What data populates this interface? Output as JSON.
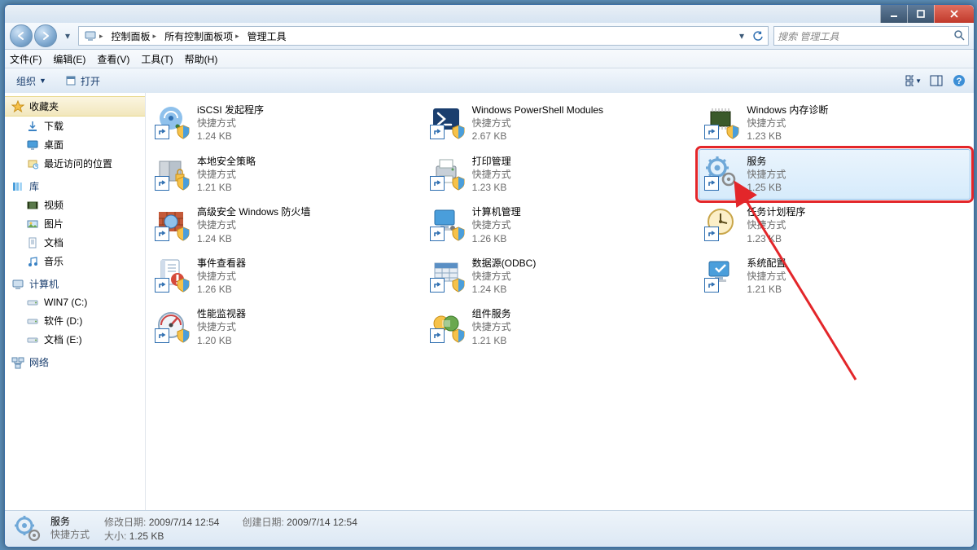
{
  "titlebar": {},
  "breadcrumb": {
    "root_icon": "computer",
    "segments": [
      "控制面板",
      "所有控制面板项",
      "管理工具"
    ]
  },
  "search": {
    "placeholder": "搜索 管理工具"
  },
  "menubar": [
    "文件(F)",
    "编辑(E)",
    "查看(V)",
    "工具(T)",
    "帮助(H)"
  ],
  "toolbar": {
    "organize": "组织",
    "open": "打开"
  },
  "sidebar": {
    "favorites": {
      "title": "收藏夹",
      "items": [
        {
          "label": "下载",
          "icon": "download"
        },
        {
          "label": "桌面",
          "icon": "desktop"
        },
        {
          "label": "最近访问的位置",
          "icon": "recent"
        }
      ]
    },
    "libraries": {
      "title": "库",
      "items": [
        {
          "label": "视频",
          "icon": "video"
        },
        {
          "label": "图片",
          "icon": "pictures"
        },
        {
          "label": "文档",
          "icon": "docs"
        },
        {
          "label": "音乐",
          "icon": "music"
        }
      ]
    },
    "computer": {
      "title": "计算机",
      "items": [
        {
          "label": "WIN7 (C:)",
          "icon": "drive"
        },
        {
          "label": "软件 (D:)",
          "icon": "drive"
        },
        {
          "label": "文档 (E:)",
          "icon": "drive"
        }
      ]
    },
    "network": {
      "title": "网络"
    }
  },
  "items": [
    {
      "title": "iSCSI 发起程序",
      "type": "快捷方式",
      "size": "1.24 KB",
      "icon": "iscsi"
    },
    {
      "title": "Windows PowerShell Modules",
      "type": "快捷方式",
      "size": "2.67 KB",
      "icon": "powershell"
    },
    {
      "title": "Windows 内存诊断",
      "type": "快捷方式",
      "size": "1.23 KB",
      "icon": "memdiag"
    },
    {
      "title": "本地安全策略",
      "type": "快捷方式",
      "size": "1.21 KB",
      "icon": "secpol"
    },
    {
      "title": "打印管理",
      "type": "快捷方式",
      "size": "1.23 KB",
      "icon": "printmgmt"
    },
    {
      "title": "服务",
      "type": "快捷方式",
      "size": "1.25 KB",
      "icon": "services",
      "selected": true,
      "highlight": true
    },
    {
      "title": "高级安全 Windows 防火墙",
      "type": "快捷方式",
      "size": "1.24 KB",
      "icon": "firewall"
    },
    {
      "title": "计算机管理",
      "type": "快捷方式",
      "size": "1.26 KB",
      "icon": "compmgmt"
    },
    {
      "title": "任务计划程序",
      "type": "快捷方式",
      "size": "1.23 KB",
      "icon": "tasksched"
    },
    {
      "title": "事件查看器",
      "type": "快捷方式",
      "size": "1.26 KB",
      "icon": "eventvwr"
    },
    {
      "title": "数据源(ODBC)",
      "type": "快捷方式",
      "size": "1.24 KB",
      "icon": "odbc"
    },
    {
      "title": "系统配置",
      "type": "快捷方式",
      "size": "1.21 KB",
      "icon": "msconfig"
    },
    {
      "title": "性能监视器",
      "type": "快捷方式",
      "size": "1.20 KB",
      "icon": "perfmon"
    },
    {
      "title": "组件服务",
      "type": "快捷方式",
      "size": "1.21 KB",
      "icon": "comsvc"
    }
  ],
  "status": {
    "title": "服务",
    "type": "快捷方式",
    "props": [
      {
        "label": "修改日期:",
        "value": "2009/7/14 12:54"
      },
      {
        "label": "大小:",
        "value": "1.25 KB"
      },
      {
        "label": "创建日期:",
        "value": "2009/7/14 12:54"
      }
    ]
  }
}
